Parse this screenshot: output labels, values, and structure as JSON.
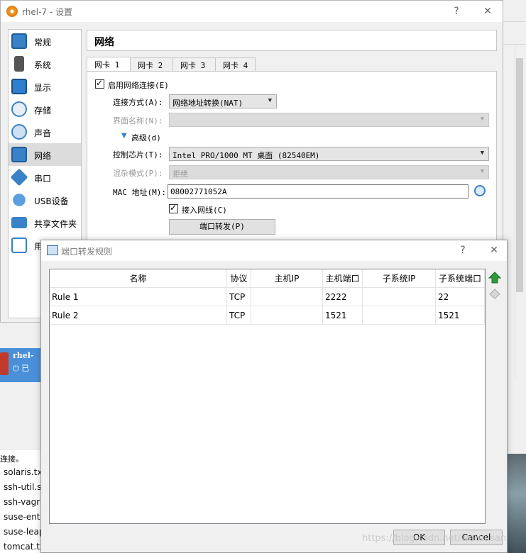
{
  "settings_window": {
    "title": "rhel-7 - 设置",
    "help_glyph": "?",
    "close_glyph": "✕",
    "categories": [
      {
        "label": "常规",
        "icon": "general-icon"
      },
      {
        "label": "系统",
        "icon": "system-icon"
      },
      {
        "label": "显示",
        "icon": "display-icon"
      },
      {
        "label": "存储",
        "icon": "storage-icon"
      },
      {
        "label": "声音",
        "icon": "audio-icon"
      },
      {
        "label": "网络",
        "icon": "network-icon",
        "selected": true
      },
      {
        "label": "串口",
        "icon": "serial-port-icon"
      },
      {
        "label": "USB设备",
        "icon": "usb-icon"
      },
      {
        "label": "共享文件夹",
        "icon": "shared-folder-icon"
      },
      {
        "label": "用",
        "icon": "user-interface-icon"
      }
    ],
    "page_title": "网络",
    "tabs": [
      "网卡 1",
      "网卡 2",
      "网卡 3",
      "网卡 4"
    ],
    "active_tab": 0,
    "adapter": {
      "enable_label": "启用网络连接(E)",
      "attached_to_label": "连接方式(A):",
      "attached_to_value": "网络地址转换(NAT)",
      "name_label": "界面名称(N):",
      "name_value": "",
      "advanced_label": "高级(d)",
      "adapter_type_label": "控制芯片(T):",
      "adapter_type_value": "Intel PRO/1000 MT 桌面 (82540EM)",
      "promiscuous_label": "混杂模式(P):",
      "promiscuous_value": "拒绝",
      "mac_label": "MAC 地址(M):",
      "mac_value": "08002771052A",
      "cable_label": "接入网线(C)",
      "port_forward_button": "端口转发(P)"
    }
  },
  "port_forward_dialog": {
    "title": "端口转发规则",
    "help_glyph": "?",
    "close_glyph": "✕",
    "columns": [
      "名称",
      "协议",
      "主机IP",
      "主机端口",
      "子系统IP",
      "子系统端口"
    ],
    "rows": [
      {
        "name": "Rule 1",
        "protocol": "TCP",
        "host_ip": "",
        "host_port": "2222",
        "guest_ip": "",
        "guest_port": "22"
      },
      {
        "name": "Rule 2",
        "protocol": "TCP",
        "host_ip": "",
        "host_port": "1521",
        "guest_ip": "",
        "guest_port": "1521"
      }
    ],
    "ok_label": "OK",
    "cancel_label": "Cancel"
  },
  "background": {
    "vm_name": "rhel-",
    "vm_state": "已",
    "status_text": "连接。",
    "files": [
      "solaris.tx",
      "ssh-util.sl",
      "ssh-vagra",
      "suse-ente",
      "suse-leap",
      "tomcat.tx"
    ],
    "watermark": "https://blog.csdn.net/weiwusan"
  },
  "colors": {
    "selection": "#dcdcdc",
    "accent_blue": "#3a82c8",
    "disabled_text": "#9a9a9a",
    "add_rule_green": "#2e9a3a"
  }
}
